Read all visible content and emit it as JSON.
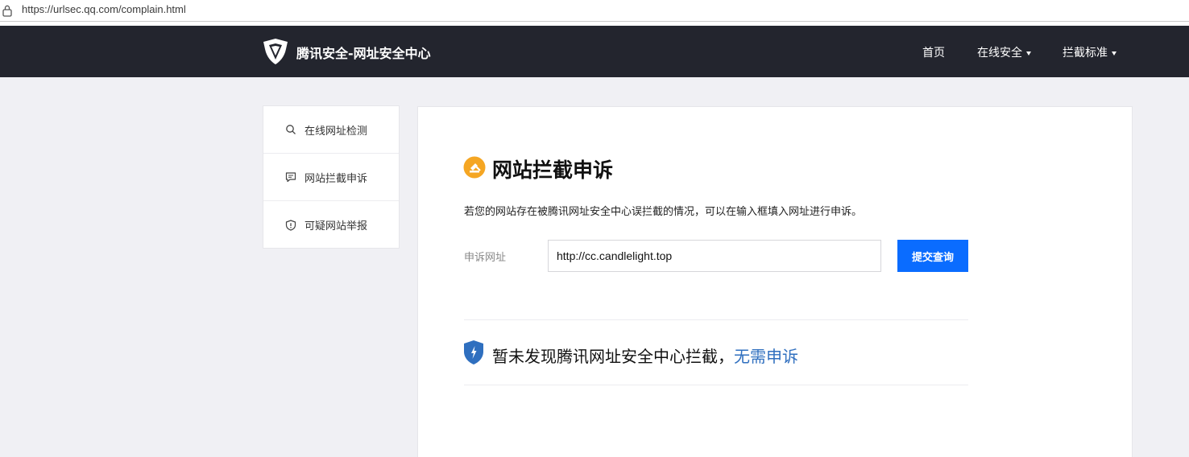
{
  "browser": {
    "url": "https://urlsec.qq.com/complain.html"
  },
  "topnav": {
    "brand": "腾讯安全-网址安全中心",
    "items": [
      {
        "label": "首页",
        "has_caret": false
      },
      {
        "label": "在线安全",
        "has_caret": true
      },
      {
        "label": "拦截标准",
        "has_caret": true
      }
    ]
  },
  "sidebar": {
    "items": [
      {
        "label": "在线网址检测",
        "icon": "search-icon"
      },
      {
        "label": "网站拦截申诉",
        "icon": "message-icon"
      },
      {
        "label": "可疑网站举报",
        "icon": "shield-alert-icon"
      }
    ]
  },
  "main": {
    "title": "网站拦截申诉",
    "description": "若您的网站存在被腾讯网址安全中心误拦截的情况，可以在输入框填入网址进行申诉。",
    "field_label": "申诉网址",
    "input_value": "http://cc.candlelight.top",
    "submit_label": "提交查询",
    "result_text": "暂未发现腾讯网址安全中心拦截，",
    "result_highlight": "无需申诉"
  },
  "colors": {
    "nav_bg": "#23252e",
    "accent_blue": "#0a6cff",
    "title_icon": "#f5a623",
    "shield": "#2f6fbf"
  }
}
